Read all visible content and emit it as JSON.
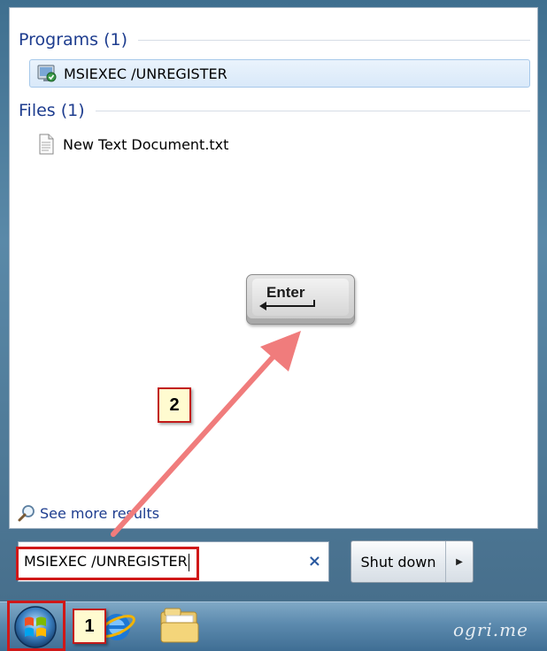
{
  "start_menu": {
    "programs_header": "Programs (1)",
    "programs": [
      {
        "label": "MSIEXEC /UNREGISTER",
        "icon": "msiexec-installer-icon",
        "selected": true
      }
    ],
    "files_header": "Files (1)",
    "files": [
      {
        "label": "New Text Document.txt",
        "icon": "text-document-icon"
      }
    ],
    "see_more_results": "See more results"
  },
  "search": {
    "value": "MSIEXEC /UNREGISTER",
    "clear_icon": "×"
  },
  "shutdown": {
    "label": "Shut down",
    "arrow": "▶"
  },
  "annotations": {
    "step1": "1",
    "step2": "2",
    "enter_key_label": "Enter"
  },
  "taskbar": {
    "watermark": "ogri.me"
  },
  "colors": {
    "highlight_red": "#d01818",
    "header_blue": "#1e3d8f",
    "arrow_pink": "#f07c7c"
  }
}
